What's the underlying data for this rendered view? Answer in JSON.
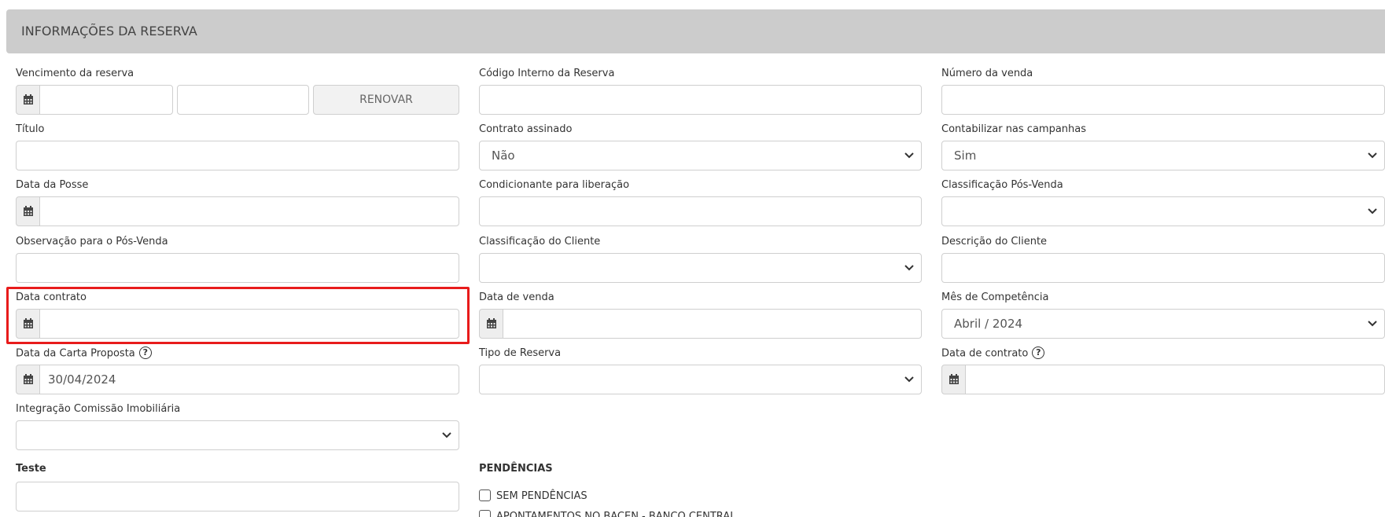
{
  "section": {
    "title": "INFORMAÇÕES DA RESERVA"
  },
  "icons": {
    "calendar": "calendar-icon",
    "chevron": "chevron-down-icon",
    "help": "help-circle-icon"
  },
  "colors": {
    "header_bg": "#cccccc",
    "highlight": "#e81b1b"
  },
  "col1": {
    "vencimento_label": "Vencimento da reserva",
    "vencimento_value1": "",
    "vencimento_value2": "",
    "renovar_label": "RENOVAR",
    "titulo_label": "Título",
    "titulo_value": "",
    "data_posse_label": "Data da Posse",
    "data_posse_value": "",
    "obs_pos_venda_label": "Observação para o Pós-Venda",
    "obs_pos_venda_value": "",
    "data_contrato_label": "Data contrato",
    "data_contrato_value": "",
    "data_carta_label": "Data da Carta Proposta",
    "data_carta_help": "?",
    "data_carta_value": "30/04/2024",
    "integracao_label": "Integração Comissão Imobiliária",
    "integracao_value": "",
    "teste_label": "Teste",
    "teste_value": ""
  },
  "col2": {
    "codigo_label": "Código Interno da Reserva",
    "codigo_value": "",
    "contrato_assinado_label": "Contrato assinado",
    "contrato_assinado_value": "Não",
    "condicionante_label": "Condicionante para liberação",
    "condicionante_value": "",
    "classificacao_cliente_label": "Classificação do Cliente",
    "classificacao_cliente_value": "",
    "data_venda_label": "Data de venda",
    "data_venda_value": "",
    "tipo_reserva_label": "Tipo de Reserva",
    "tipo_reserva_value": "",
    "pendencias_label": "PENDÊNCIAS",
    "pendencias_items": [
      "SEM PENDÊNCIAS",
      "APONTAMENTOS NO BACEN - BANCO CENTRAL"
    ]
  },
  "col3": {
    "numero_venda_label": "Número da venda",
    "numero_venda_value": "",
    "contabilizar_label": "Contabilizar nas campanhas",
    "contabilizar_value": "Sim",
    "classificacao_pos_label": "Classificação Pós-Venda",
    "classificacao_pos_value": "",
    "descricao_cliente_label": "Descrição do Cliente",
    "descricao_cliente_value": "",
    "mes_competencia_label": "Mês de Competência",
    "mes_competencia_value": "Abril / 2024",
    "data_de_contrato_label": "Data de contrato",
    "data_de_contrato_help": "?",
    "data_de_contrato_value": ""
  }
}
